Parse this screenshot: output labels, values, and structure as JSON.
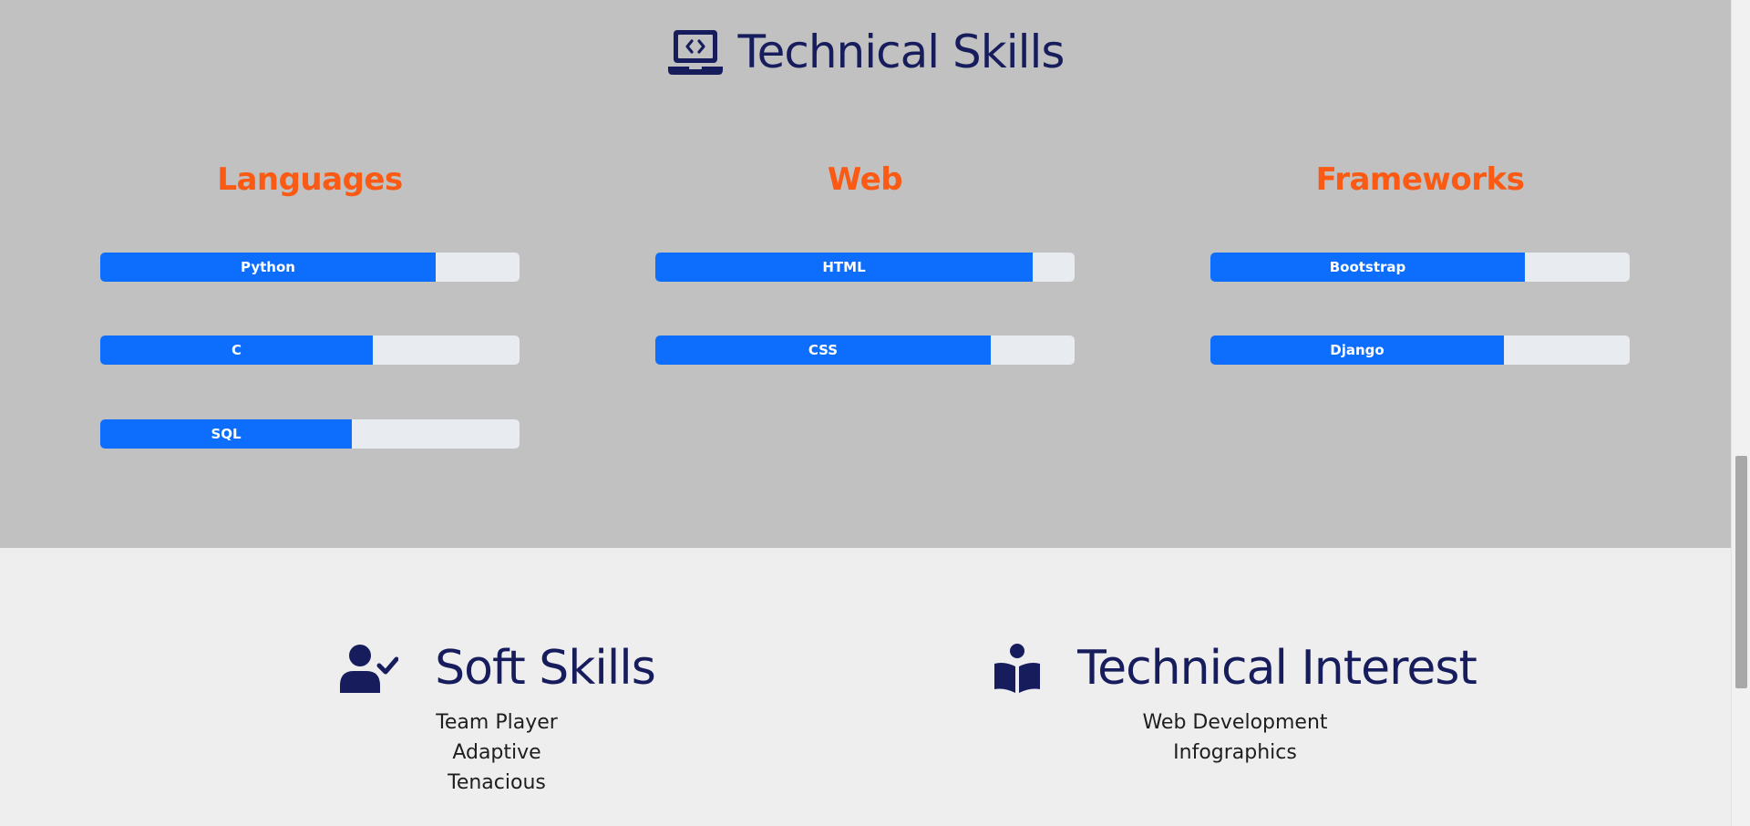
{
  "technical_skills": {
    "title": "Technical Skills",
    "icon": "laptop-code-icon",
    "categories": [
      {
        "heading": "Languages",
        "skills": [
          {
            "name": "Python",
            "level": 80
          },
          {
            "name": "C",
            "level": 65
          },
          {
            "name": "SQL",
            "level": 60
          }
        ]
      },
      {
        "heading": "Web",
        "skills": [
          {
            "name": "HTML",
            "level": 90
          },
          {
            "name": "CSS",
            "level": 80
          }
        ]
      },
      {
        "heading": "Frameworks",
        "skills": [
          {
            "name": "Bootstrap",
            "level": 75
          },
          {
            "name": "Django",
            "level": 70
          }
        ]
      }
    ]
  },
  "soft_skills": {
    "title": "Soft Skills",
    "icon": "user-check-icon",
    "items": [
      "Team Player",
      "Adaptive",
      "Tenacious"
    ]
  },
  "technical_interest": {
    "title": "Technical Interest",
    "icon": "book-reader-icon",
    "items": [
      "Web Development",
      "Infographics"
    ]
  },
  "colors": {
    "band_background": "#c1c1c1",
    "page_background": "#eeeeee",
    "title_navy": "#171d5c",
    "category_orange": "#fa5a13",
    "progress_blue": "#0d6efd",
    "progress_track": "#e8ebef"
  }
}
